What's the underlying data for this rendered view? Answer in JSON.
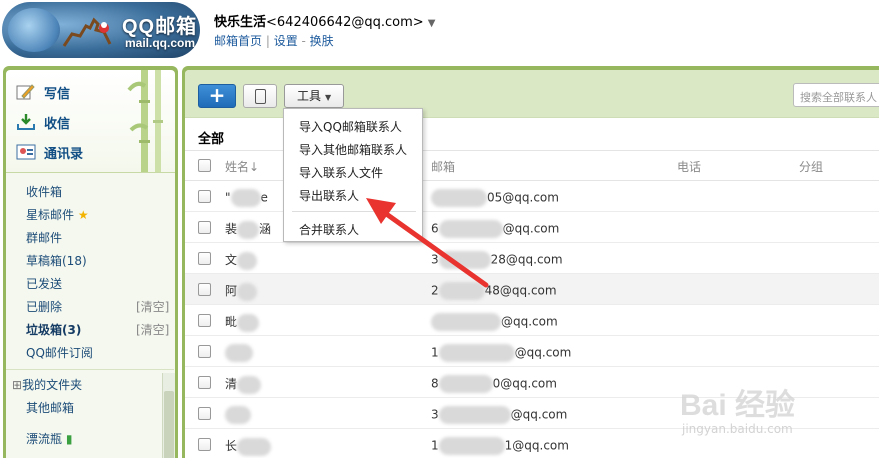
{
  "header": {
    "logo_title": "QQ邮箱",
    "logo_sub": "mail.qq.com",
    "user_name": "快乐生活",
    "user_email": "<642406642@qq.com>",
    "links": [
      "邮箱首页",
      "设置",
      "换肤"
    ]
  },
  "sidebar": {
    "main_buttons": [
      {
        "label": "写信",
        "icon": "pencil-icon"
      },
      {
        "label": "收信",
        "icon": "inbox-download-icon"
      },
      {
        "label": "通讯录",
        "icon": "address-card-icon"
      }
    ],
    "folders": [
      {
        "label": "收件箱"
      },
      {
        "label": "星标邮件",
        "icon": "star-icon"
      },
      {
        "label": "群邮件"
      },
      {
        "label": "草稿箱(18)"
      },
      {
        "label": "已发送"
      },
      {
        "label": "已删除",
        "action": "[清空]"
      },
      {
        "label": "垃圾箱(3)",
        "action": "[清空]"
      },
      {
        "label": "QQ邮件订阅"
      },
      {
        "label": "我的文件夹",
        "expander": "⊞"
      },
      {
        "label": "其他邮箱"
      },
      {
        "label": "漂流瓶",
        "icon": "bottle-icon"
      }
    ]
  },
  "toolbar": {
    "add_label": "+",
    "tools_label": "工具",
    "search_placeholder": "搜索全部联系人"
  },
  "contacts": {
    "section_title": "全部",
    "columns": [
      "姓名↓",
      "邮箱",
      "电话",
      "分组"
    ],
    "rows": [
      {
        "name": "\"",
        "name_tail": "e",
        "email_head": "",
        "email_tail": "05@qq.com"
      },
      {
        "name": "裴",
        "name_tail": "涵",
        "email_head": "6",
        "email_tail": "@qq.com"
      },
      {
        "name": "文",
        "name_tail": "",
        "email_head": "3",
        "email_tail": "28@qq.com"
      },
      {
        "name": "阿",
        "name_tail": "",
        "email_head": "2",
        "email_tail": "48@qq.com"
      },
      {
        "name": "毗",
        "name_tail": "",
        "email_head": "",
        "email_tail": "@qq.com"
      },
      {
        "name": "",
        "name_tail": "",
        "email_head": "1",
        "email_tail": "@qq.com"
      },
      {
        "name": "清",
        "name_tail": "",
        "email_head": "8",
        "email_tail": "0@qq.com"
      },
      {
        "name": "",
        "name_tail": "",
        "email_head": "3",
        "email_tail": "@qq.com"
      },
      {
        "name": "长",
        "name_tail": "",
        "email_head": "1",
        "email_tail": "1@qq.com"
      }
    ]
  },
  "tools_menu": {
    "items": [
      "导入QQ邮箱联系人",
      "导入其他邮箱联系人",
      "导入联系人文件",
      "导出联系人",
      "合并联系人"
    ],
    "highlighted": "导出联系人"
  },
  "annotation": {
    "arrow_color": "#e8332e"
  },
  "watermark": {
    "main": "Bai 经验",
    "sub": "jingyan.baidu.com"
  }
}
